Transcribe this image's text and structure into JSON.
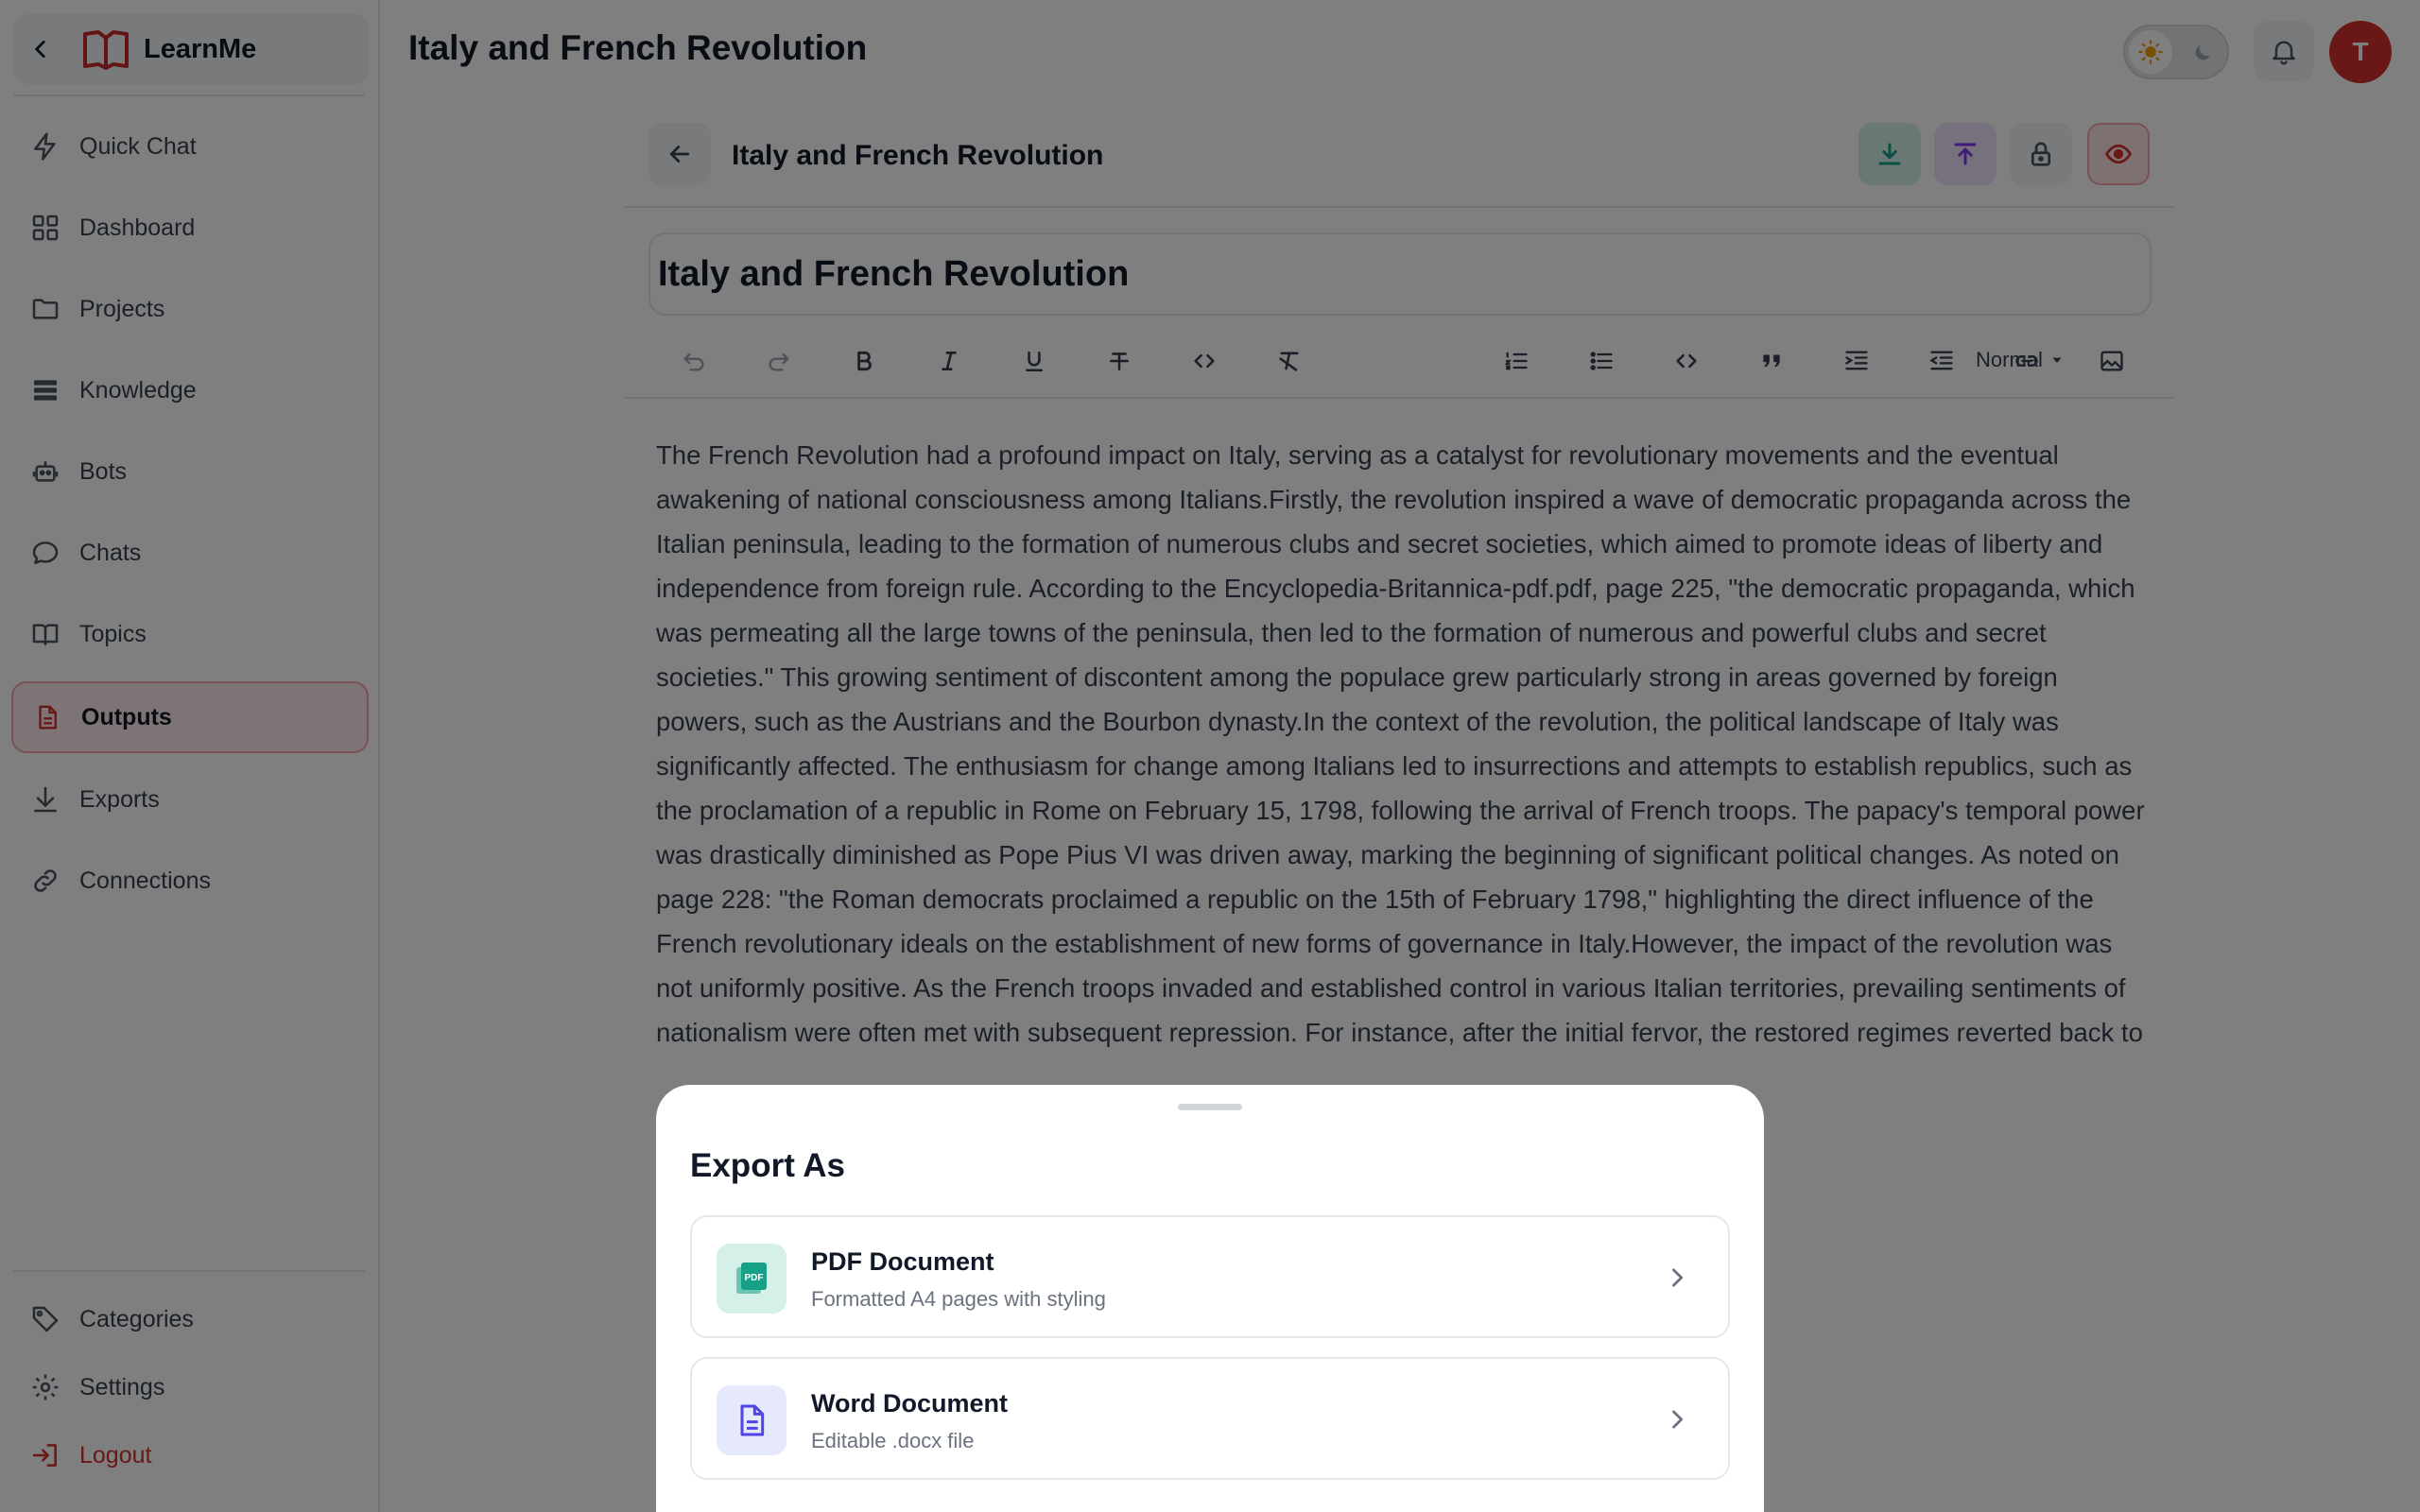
{
  "sidebar": {
    "brand": "LearnMe",
    "items": [
      {
        "label": "Quick Chat"
      },
      {
        "label": "Dashboard"
      },
      {
        "label": "Projects"
      },
      {
        "label": "Knowledge"
      },
      {
        "label": "Bots"
      },
      {
        "label": "Chats"
      },
      {
        "label": "Topics"
      },
      {
        "label": "Outputs"
      },
      {
        "label": "Exports"
      },
      {
        "label": "Connections"
      }
    ],
    "bottom": [
      {
        "label": "Categories"
      },
      {
        "label": "Settings"
      },
      {
        "label": "Logout"
      }
    ]
  },
  "header": {
    "title": "Italy and French Revolution",
    "avatar_initial": "T"
  },
  "document": {
    "name": "Italy and French Revolution",
    "title_value": "Italy and French Revolution",
    "block_format": "Normal",
    "body": "The French Revolution had a profound impact on Italy, serving as a catalyst for revolutionary movements and the eventual awakening of national consciousness among Italians.Firstly, the revolution inspired a wave of democratic propaganda across the Italian peninsula, leading to the formation of numerous clubs and secret societies, which aimed to promote ideas of liberty and independence from foreign rule. According to the Encyclopedia-Britannica-pdf.pdf, page 225, \"the democratic propaganda, which was permeating all the large towns of the peninsula, then led to the formation of numerous and powerful clubs and secret societies.\" This growing sentiment of discontent among the populace grew particularly strong in areas governed by foreign powers, such as the Austrians and the Bourbon dynasty.In the context of the revolution, the political landscape of Italy was significantly affected. The enthusiasm for change among Italians led to insurrections and attempts to establish republics, such as the proclamation of a republic in Rome on February 15, 1798, following the arrival of French troops. The papacy's temporal power was drastically diminished as Pope Pius VI was driven away, marking the beginning of significant political changes. As noted on page 228: \"the Roman democrats proclaimed a republic on the 15th of February 1798,\" highlighting the direct influence of the French revolutionary ideals on the establishment of new forms of governance in Italy.However, the impact of the revolution was not uniformly positive. As the French troops invaded and established control in various Italian territories, prevailing sentiments of nationalism were often met with subsequent repression. For instance, after the initial fervor, the restored regimes reverted back to"
  },
  "export_sheet": {
    "title": "Export As",
    "options": [
      {
        "title": "PDF Document",
        "subtitle": "Formatted A4 pages with styling",
        "badge_text": "PDF"
      },
      {
        "title": "Word Document",
        "subtitle": "Editable .docx file"
      }
    ]
  },
  "colors": {
    "accent": "#d32f2f",
    "active_bg": "#fde8ea",
    "download": "#16a085",
    "publish": "#7c3aed",
    "word": "#4f46e5"
  }
}
